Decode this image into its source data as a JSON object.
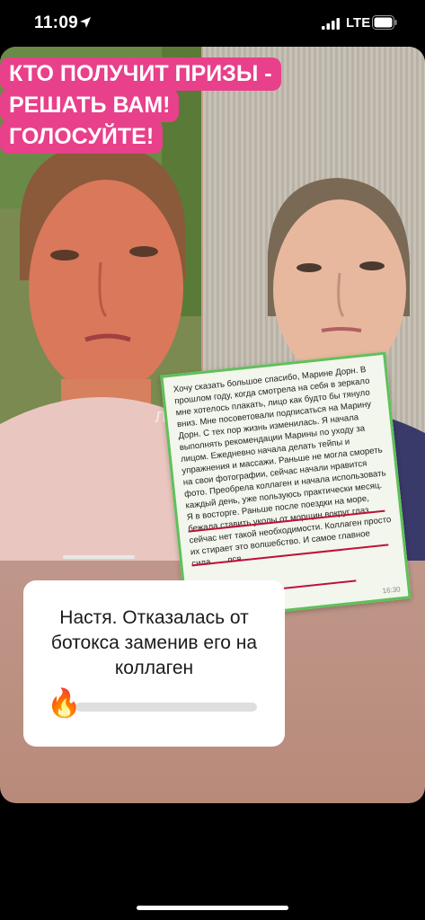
{
  "status_bar": {
    "time": "11:09",
    "network": "LTE"
  },
  "story": {
    "headline": [
      "КТО ПОЛУЧИТ ПРИЗЫ -",
      "РЕШАТЬ ВАМ!",
      "ГОЛОСУЙТЕ!"
    ],
    "headline_color": "#e8408a",
    "watermark": "ле",
    "testimonial_text": "Хочу сказать большое спасибо, Марине Дорн. В прошлом году, когда смотрела на себя в зеркало мне хотелось плакать, лицо как будто бы тянуло вниз. Мне посоветовали подписаться на Марину Дорн. С тех пор жизнь изменилась. Я начала выполнять рекомендации Марины по уходу за лицом. Ежедневно начала делать тейпы и упражнения и массажи. Раньше не могла смореть на свои фотографии, сейчас начали нравится фото. Преобрела коллаген и начала использовать каждый день, уже пользуюсь практически месяц. Я в восторге. Раньше после поездки на море, бежала ставить уколы от морщин вокруг глаз, сейчас нет такой необходимости. Коллаген просто их стирает это волшебство. И самое главное сила... ...лся.",
    "testimonial_time": "16:30",
    "poll": {
      "question": "Настя. Отказалась от ботокса заменив его на коллаген",
      "emoji": "🔥",
      "level": 0
    }
  }
}
